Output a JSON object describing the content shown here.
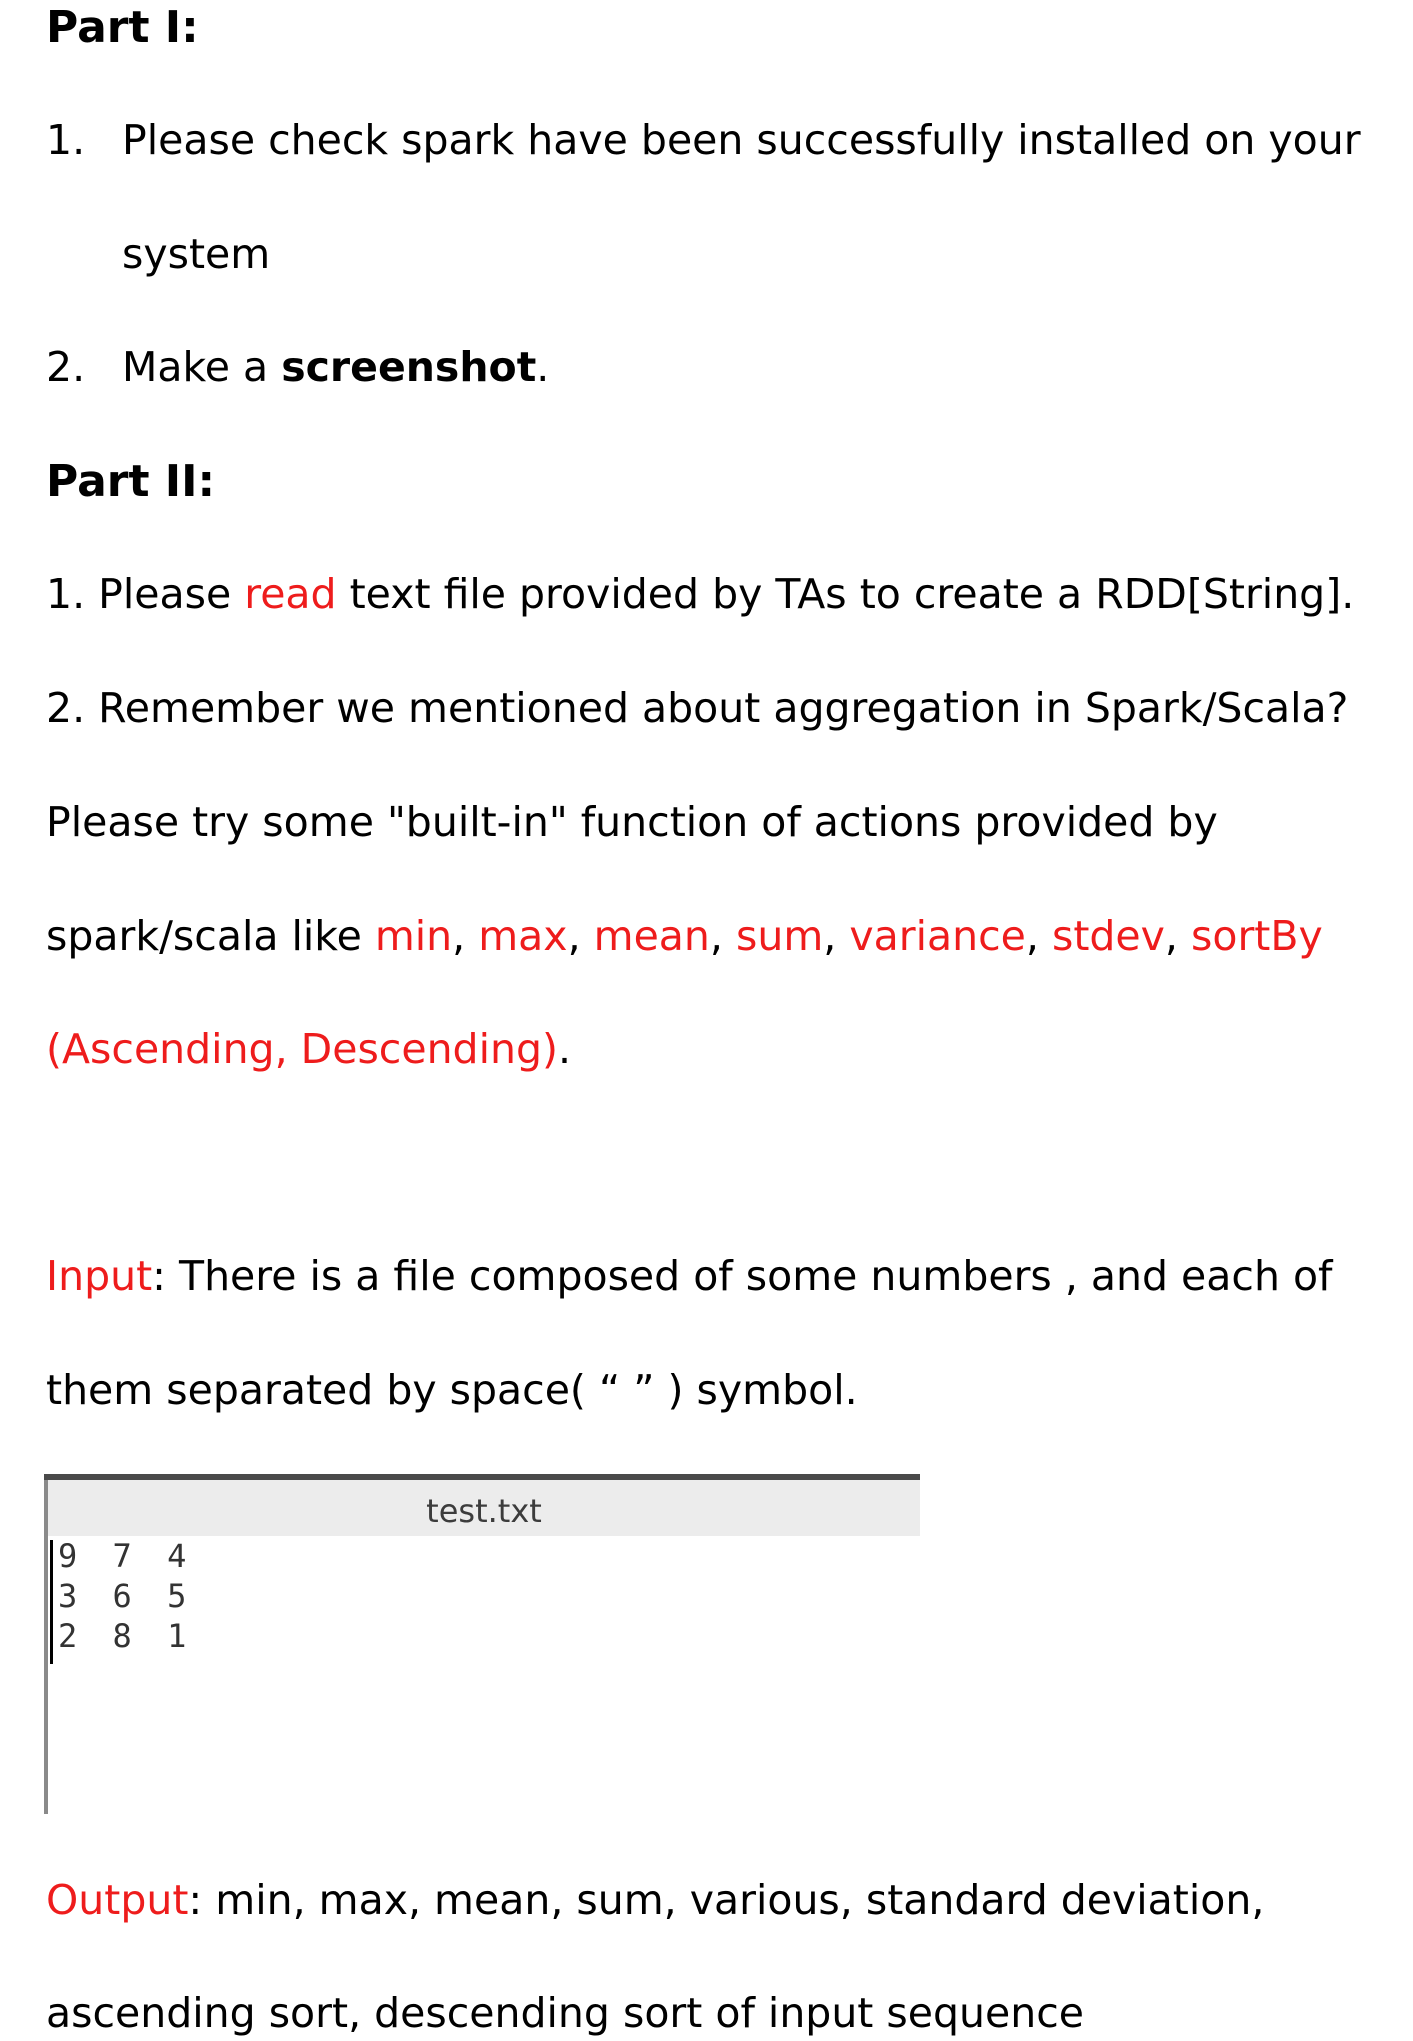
{
  "part1": {
    "heading": "Part I:",
    "items": [
      {
        "num": "1.",
        "text_line1": "Please check spark have been successfully installed on your",
        "text_line2": "system"
      },
      {
        "num": "2.",
        "text_before": "Make a ",
        "text_bold": "screenshot",
        "text_after": "."
      }
    ]
  },
  "part2": {
    "heading": "Part II:",
    "item1": {
      "prefix": "1. Please ",
      "red": "read",
      "suffix": " text file provided by TAs to create a RDD[String]."
    },
    "item2_line1": "2. Remember we mentioned about aggregation in Spark/Scala?",
    "item2_line2": "Please try some \"built-in\" function of actions provided by",
    "item2_line3_prefix": "spark/scala like ",
    "functions": [
      "min",
      "max",
      "mean",
      "sum",
      "variance",
      "stdev",
      "sortBy"
    ],
    "item2_line4_red": "(Ascending, Descending)",
    "item2_line4_suffix": "."
  },
  "input": {
    "label": "Input",
    "line1_rest": ": There is a file composed of some numbers , and each of",
    "line2": "them separated by space( “ ” ) symbol."
  },
  "editor": {
    "title": "test.txt",
    "lines": [
      "9 7 4",
      "3 6 5",
      "2 8 1"
    ]
  },
  "output": {
    "label": "Output",
    "line1_rest": ": min, max, mean, sum, various, standard deviation,",
    "line2": "ascending sort, descending sort of input sequence"
  }
}
